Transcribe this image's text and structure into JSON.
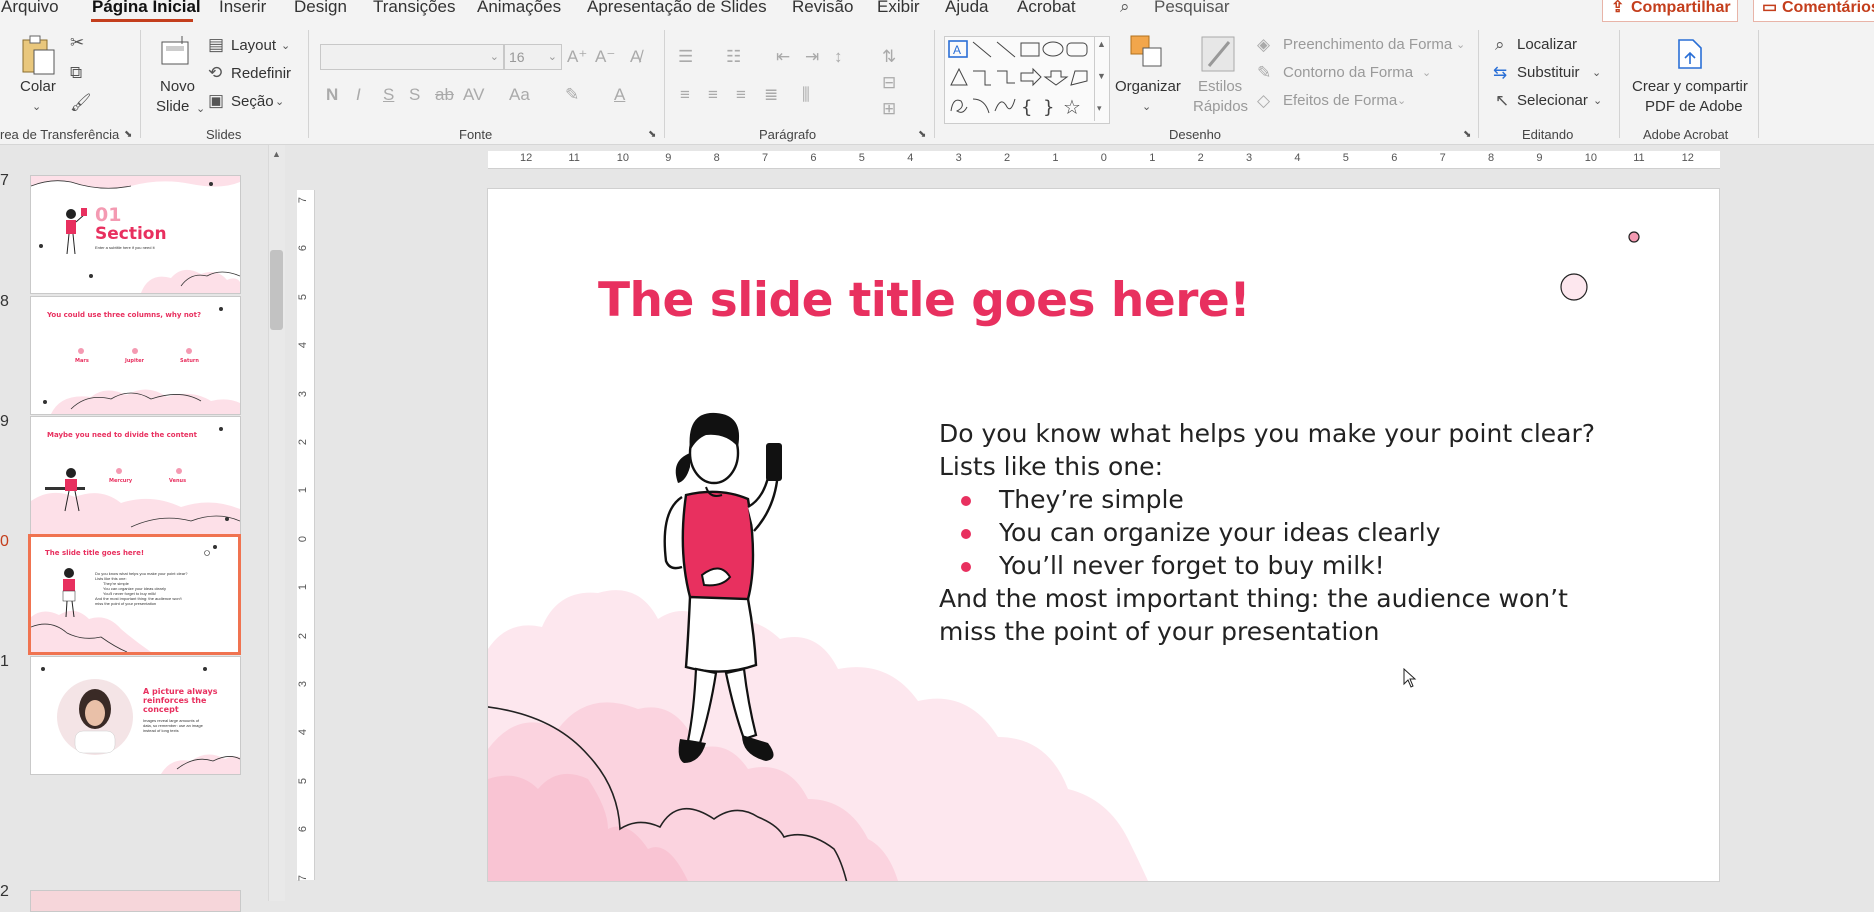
{
  "menu": {
    "items": [
      "Arquivo",
      "Página Inicial",
      "Inserir",
      "Design",
      "Transições",
      "Animações",
      "Apresentação de Slides",
      "Revisão",
      "Exibir",
      "Ajuda",
      "Acrobat"
    ],
    "search_label": "Pesquisar",
    "share_label": "Compartilhar",
    "comments_label": "Comentários"
  },
  "ribbon": {
    "clipboard": {
      "paste_label": "Colar",
      "group_label": "rea de Transferência"
    },
    "slides": {
      "new_slide_line1": "Novo",
      "new_slide_line2": "Slide",
      "layout_label": "Layout",
      "reset_label": "Redefinir",
      "section_label": "Seção",
      "group_label": "Slides"
    },
    "font": {
      "font_size": "16",
      "bold": "N",
      "italic": "I",
      "underline": "S",
      "shadow": "S",
      "strike": "ab",
      "spacing": "AV",
      "case": "Aa",
      "group_label": "Fonte"
    },
    "paragraph": {
      "group_label": "Parágrafo"
    },
    "drawing": {
      "arrange_label": "Organizar",
      "quick_styles_line1": "Estilos",
      "quick_styles_line2": "Rápidos",
      "shape_fill": "Preenchimento da Forma",
      "shape_outline": "Contorno da Forma",
      "shape_effects": "Efeitos de Forma",
      "group_label": "Desenho"
    },
    "editing": {
      "find_label": "Localizar",
      "replace_label": "Substituir",
      "select_label": "Selecionar",
      "group_label": "Editando"
    },
    "acrobat": {
      "create_line1": "Crear y compartir",
      "create_line2": "PDF de Adobe",
      "group_label": "Adobe Acrobat"
    }
  },
  "thumbnails": [
    {
      "number": "7",
      "title_line1": "01",
      "title_line2": "Section",
      "subtitle": "Enter a subtitle here if you need it"
    },
    {
      "number": "8",
      "title": "You could use three columns, why not?",
      "columns": [
        "Mars",
        "Jupiter",
        "Saturn"
      ]
    },
    {
      "number": "9",
      "title": "Maybe you need to divide the content",
      "columns": [
        "Mercury",
        "Venus"
      ]
    },
    {
      "number": "0",
      "title": "The slide title goes here!",
      "lines": [
        "Do you know what helps you make your point clear?",
        "Lists like this one:",
        "They're simple",
        "You can organize your ideas clearly",
        "You'll never forget to buy milk!",
        "And the most important thing: the audience won't",
        "miss the point of your presentation"
      ]
    },
    {
      "number": "1",
      "title_lines": [
        "A picture always",
        "reinforces the",
        "concept"
      ],
      "body": [
        "Images reveal large amounts of",
        "data, so remember: use an image",
        "instead of long texts"
      ]
    },
    {
      "number": "2"
    }
  ],
  "slide": {
    "title": "The slide title goes here!",
    "intro_line1": "Do you know what helps you make your point clear?",
    "intro_line2": "Lists like this one:",
    "bullets": [
      "They’re simple",
      "You can organize your ideas clearly",
      "You’ll never forget to buy milk!"
    ],
    "outro_line1": "And the most important thing: the audience won’t",
    "outro_line2": "miss the point of your presentation"
  },
  "ruler": {
    "h_ticks": [
      "12",
      "11",
      "10",
      "9",
      "8",
      "7",
      "6",
      "5",
      "4",
      "3",
      "2",
      "1",
      "0",
      "1",
      "2",
      "3",
      "4",
      "5",
      "6",
      "7",
      "8",
      "9",
      "10",
      "11",
      "12"
    ],
    "v_ticks": [
      "7",
      "6",
      "5",
      "4",
      "3",
      "2",
      "1",
      "0",
      "1",
      "2",
      "3",
      "4",
      "5",
      "6",
      "7"
    ]
  },
  "colors": {
    "accent": "#e8305f",
    "office_red": "#c43e1c",
    "cloud_pink": "#fde0e8"
  }
}
